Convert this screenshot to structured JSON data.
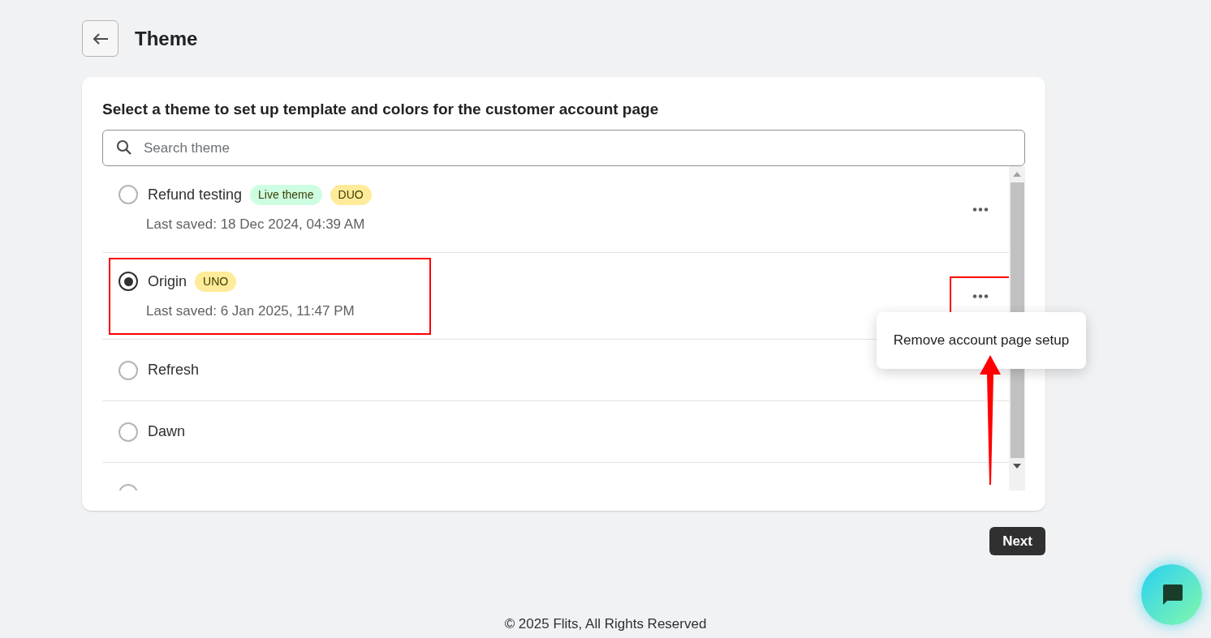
{
  "header": {
    "title": "Theme"
  },
  "card": {
    "heading": "Select a theme to set up template and colors for the customer account page",
    "search": {
      "placeholder": "Search theme"
    }
  },
  "themes": [
    {
      "name": "Refund testing",
      "badges": [
        {
          "label": "Live theme",
          "color": "#cdfee1"
        },
        {
          "label": "DUO",
          "color": "#ffeb99"
        }
      ],
      "saved": "Last saved: 18 Dec 2024, 04:39 AM",
      "selected": false,
      "highlighted": false,
      "menu_highlighted": false
    },
    {
      "name": "Origin",
      "badges": [
        {
          "label": "UNO",
          "color": "#ffeb99"
        }
      ],
      "saved": "Last saved: 6 Jan 2025, 11:47 PM",
      "selected": true,
      "highlighted": true,
      "menu_highlighted": true
    },
    {
      "name": "Refresh",
      "selected": false,
      "highlighted": false
    },
    {
      "name": "Dawn",
      "selected": false,
      "highlighted": false
    },
    {
      "selected": false,
      "highlighted": false
    }
  ],
  "popup_menu": {
    "item": "Remove account page setup"
  },
  "next_button": "Next",
  "footer": "© 2025 Flits, All Rights Reserved"
}
